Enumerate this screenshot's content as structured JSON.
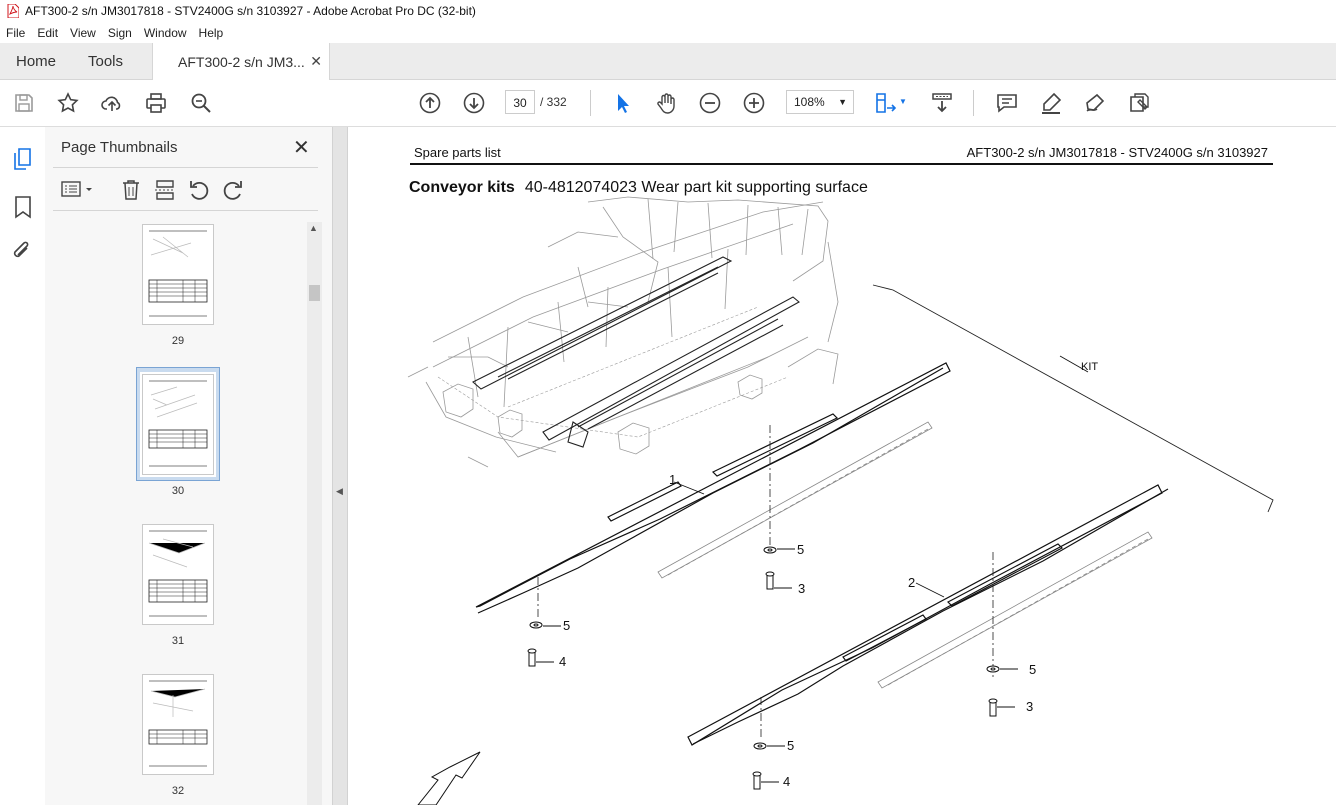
{
  "window": {
    "title": "AFT300-2  s/n JM3017818 - STV2400G s/n 3103927 - Adobe Acrobat Pro DC (32-bit)"
  },
  "menu": [
    "File",
    "Edit",
    "View",
    "Sign",
    "Window",
    "Help"
  ],
  "tabs": {
    "home": "Home",
    "tools": "Tools",
    "document": "AFT300-2  s/n JM3..."
  },
  "toolbar": {
    "current_page": "30",
    "total_pages": "/ 332",
    "zoom": "108%"
  },
  "panel": {
    "title": "Page Thumbnails",
    "thumbnails": [
      {
        "page": "29",
        "selected": false
      },
      {
        "page": "30",
        "selected": true
      },
      {
        "page": "31",
        "selected": false
      },
      {
        "page": "32",
        "selected": false
      }
    ]
  },
  "document": {
    "header_left": "Spare parts list",
    "header_right": "AFT300-2  s/n JM3017818 - STV2400G s/n 3103927",
    "section": "Conveyor kits",
    "title": "40-4812074023 Wear part kit supporting surface",
    "callouts": {
      "kit": "KIT",
      "c1": "1",
      "c2": "2",
      "c3a": "3",
      "c3b": "3",
      "c4a": "4",
      "c4b": "4",
      "c5a": "5",
      "c5b": "5",
      "c5c": "5",
      "c5d": "5"
    }
  }
}
